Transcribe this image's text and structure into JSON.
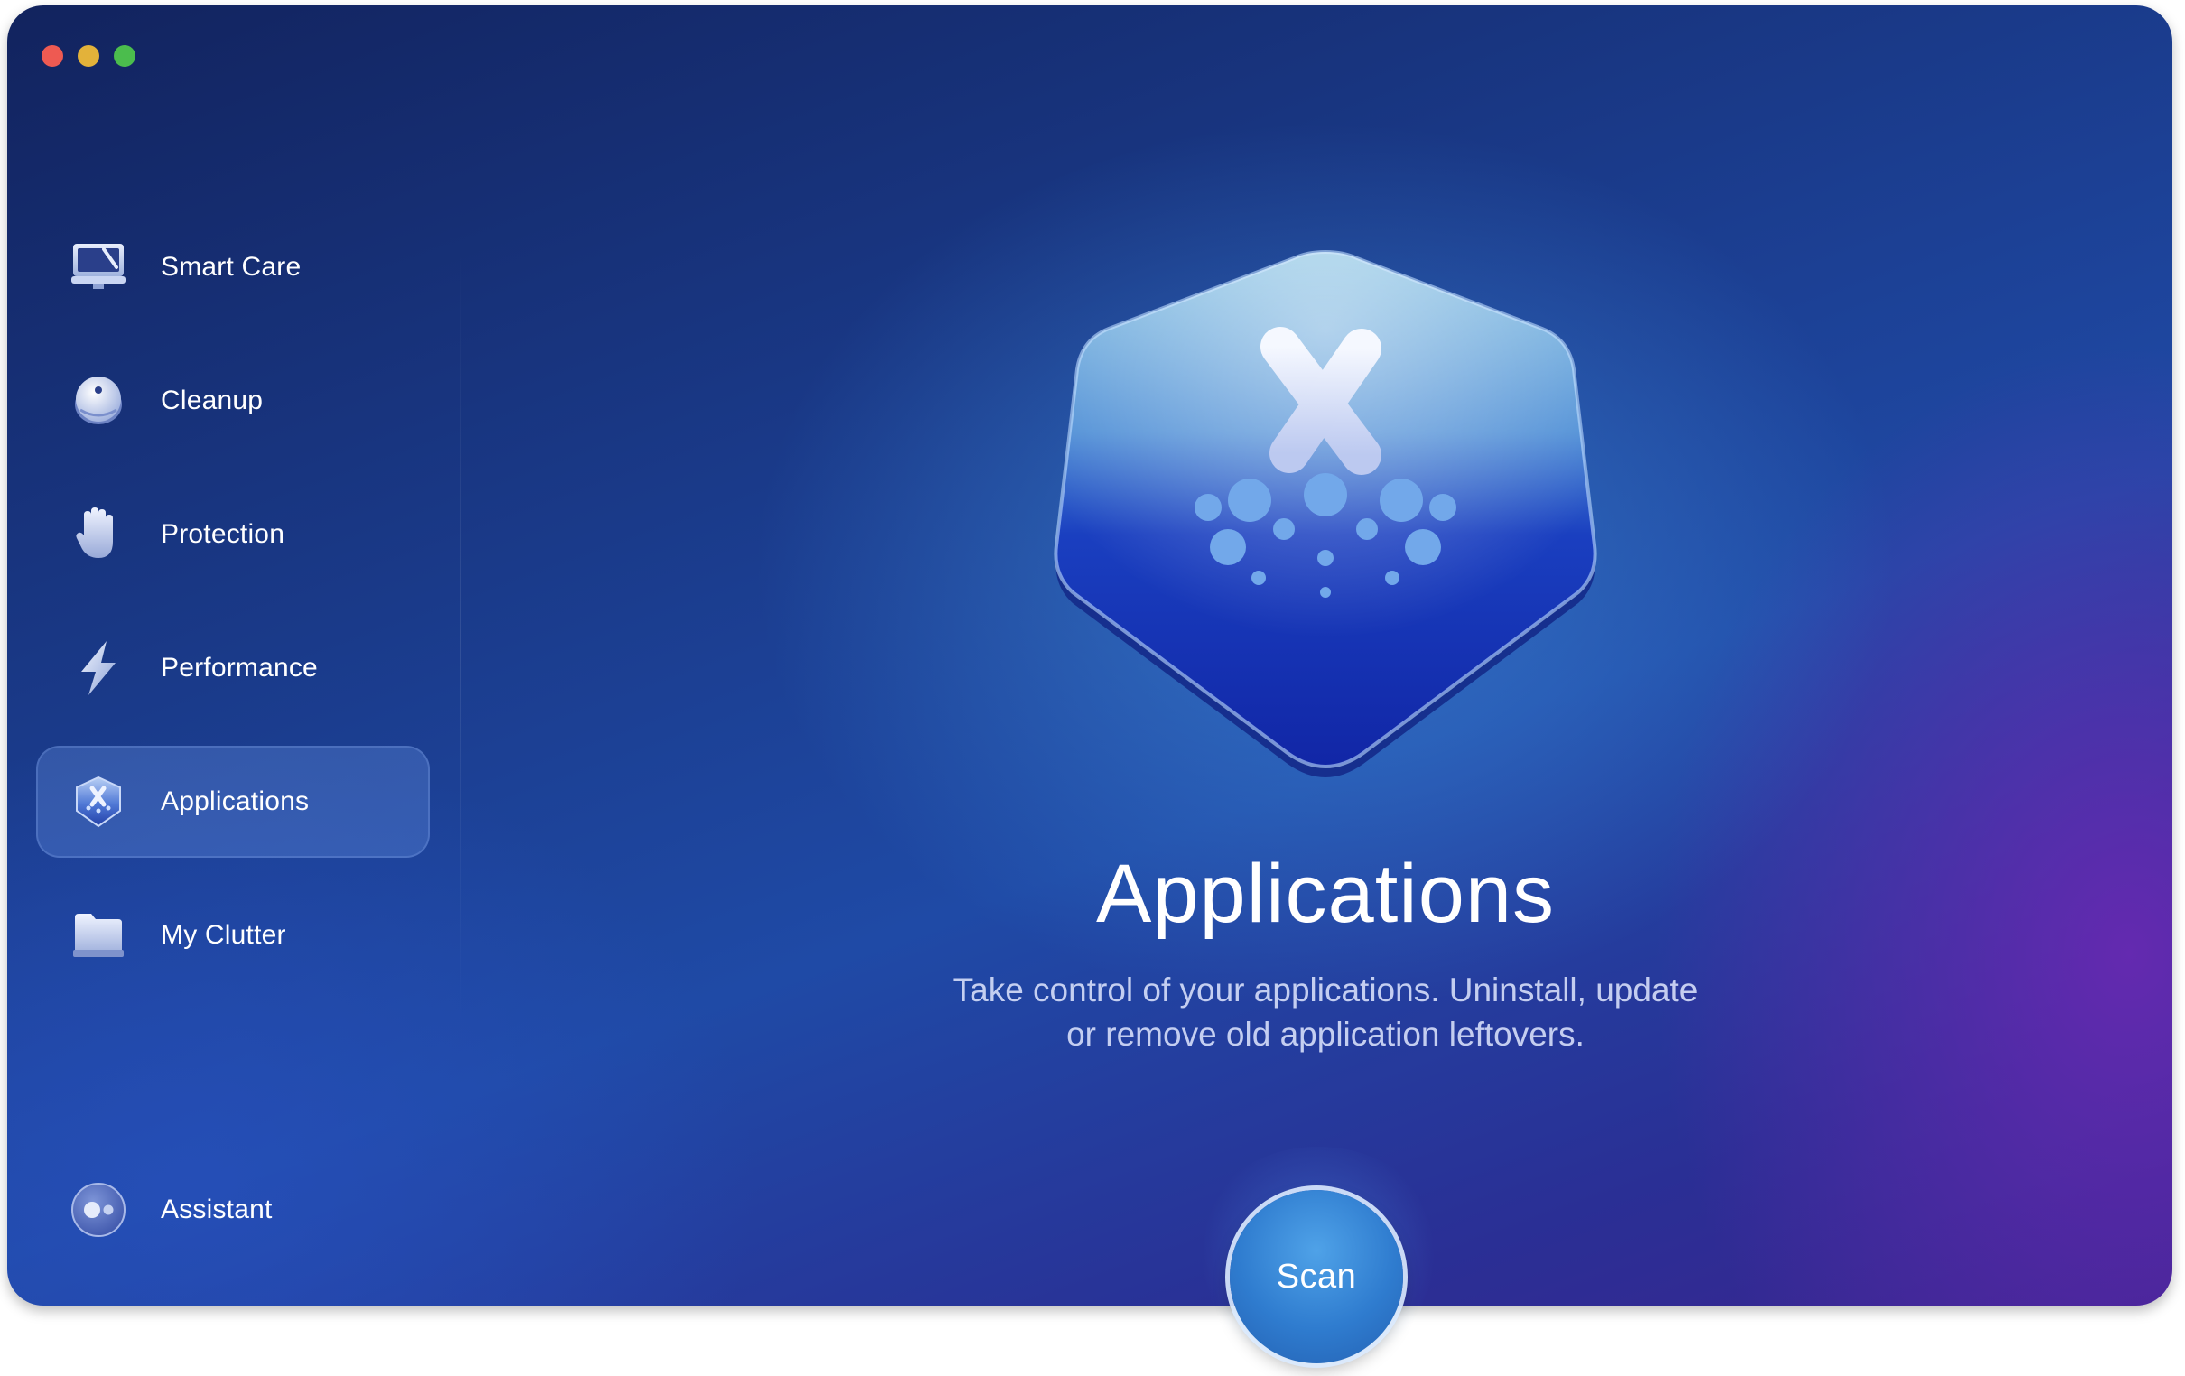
{
  "window": {
    "controls": [
      "close",
      "minimize",
      "zoom"
    ]
  },
  "sidebar": {
    "items": [
      {
        "label": "Smart Care",
        "icon": "monitor-icon"
      },
      {
        "label": "Cleanup",
        "icon": "disc-icon"
      },
      {
        "label": "Protection",
        "icon": "hand-icon"
      },
      {
        "label": "Performance",
        "icon": "lightning-icon"
      },
      {
        "label": "Applications",
        "icon": "applications-badge-icon",
        "active": true
      },
      {
        "label": "My Clutter",
        "icon": "folder-icon"
      }
    ],
    "assistant": {
      "label": "Assistant",
      "icon": "assistant-icon"
    }
  },
  "main": {
    "title": "Applications",
    "description_line1": "Take control of your applications. Uninstall, update",
    "description_line2": "or remove old application leftovers.",
    "scan_label": "Scan"
  },
  "colors": {
    "accent": "#2f7ccf",
    "background_top": "#12235e",
    "background_purple": "#3a2590",
    "close": "#ee5a52",
    "minimize": "#e3b23a",
    "zoom": "#4bbd4d"
  }
}
